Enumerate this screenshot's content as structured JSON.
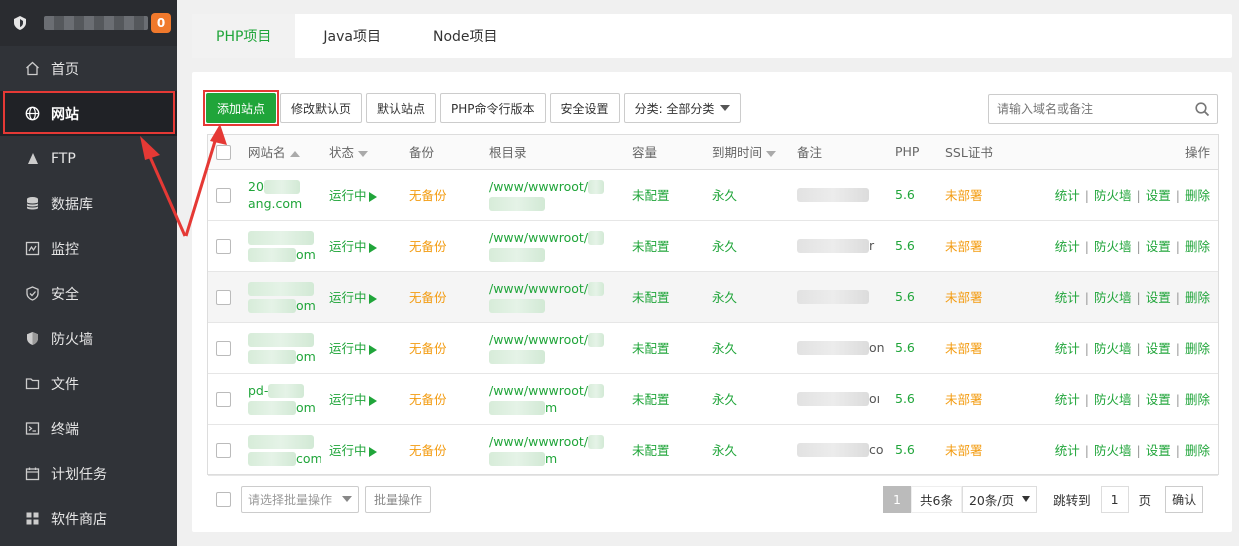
{
  "sidebar": {
    "badge": "0",
    "items": [
      {
        "label": "首页",
        "icon": "home-icon"
      },
      {
        "label": "网站",
        "icon": "globe-icon",
        "active": true
      },
      {
        "label": "FTP",
        "icon": "ftp-icon"
      },
      {
        "label": "数据库",
        "icon": "database-icon"
      },
      {
        "label": "监控",
        "icon": "monitor-icon"
      },
      {
        "label": "安全",
        "icon": "shield-icon"
      },
      {
        "label": "防火墙",
        "icon": "firewall-icon"
      },
      {
        "label": "文件",
        "icon": "folder-icon"
      },
      {
        "label": "终端",
        "icon": "terminal-icon"
      },
      {
        "label": "计划任务",
        "icon": "calendar-icon"
      },
      {
        "label": "软件商店",
        "icon": "grid-icon"
      }
    ]
  },
  "tabs": [
    {
      "label": "PHP项目",
      "active": true
    },
    {
      "label": "Java项目"
    },
    {
      "label": "Node项目"
    }
  ],
  "toolbar": {
    "add_site": "添加站点",
    "edit_default_page": "修改默认页",
    "default_site": "默认站点",
    "php_cli_version": "PHP命令行版本",
    "security_settings": "安全设置",
    "category": "分类: 全部分类"
  },
  "search": {
    "placeholder": "请输入域名或备注"
  },
  "table": {
    "headers": {
      "name": "网站名",
      "status": "状态",
      "backup": "备份",
      "root": "根目录",
      "quota": "容量",
      "expire": "到期时间",
      "note": "备注",
      "php": "PHP",
      "ssl": "SSL证书",
      "ops": "操作"
    },
    "rows": [
      {
        "name_top": "20",
        "name_bottom": "ang.com",
        "status": "运行中",
        "backup": "无备份",
        "root_top": "/www/wwwroot/",
        "root_bottom": "",
        "quota": "未配置",
        "expire": "永久",
        "note_tail": "",
        "php": "5.6",
        "ssl": "未部署"
      },
      {
        "name_top": "",
        "name_bottom": "om",
        "status": "运行中",
        "backup": "无备份",
        "root_top": "/www/wwwroot/",
        "root_bottom": "",
        "quota": "未配置",
        "expire": "永久",
        "note_tail": "r",
        "php": "5.6",
        "ssl": "未部署"
      },
      {
        "name_top": "",
        "name_bottom": "om",
        "status": "运行中",
        "backup": "无备份",
        "root_top": "/www/wwwroot/",
        "root_bottom": "",
        "quota": "未配置",
        "expire": "永久",
        "note_tail": "",
        "php": "5.6",
        "ssl": "未部署"
      },
      {
        "name_top": "",
        "name_bottom": "om",
        "status": "运行中",
        "backup": "无备份",
        "root_top": "/www/wwwroot/",
        "root_bottom": "",
        "quota": "未配置",
        "expire": "永久",
        "note_tail": "on",
        "php": "5.6",
        "ssl": "未部署"
      },
      {
        "name_top": "pd-",
        "name_bottom": "om",
        "status": "运行中",
        "backup": "无备份",
        "root_top": "/www/wwwroot/",
        "root_bottom": "m",
        "quota": "未配置",
        "expire": "永久",
        "note_tail": "oı",
        "php": "5.6",
        "ssl": "未部署"
      },
      {
        "name_top": "",
        "name_bottom": "com",
        "status": "运行中",
        "backup": "无备份",
        "root_top": "/www/wwwroot/",
        "root_bottom": "m",
        "quota": "未配置",
        "expire": "永久",
        "note_tail": "co",
        "php": "5.6",
        "ssl": "未部署"
      }
    ],
    "ops": [
      "统计",
      "防火墙",
      "设置",
      "删除"
    ]
  },
  "footer": {
    "batch_placeholder": "请选择批量操作",
    "batch_button": "批量操作",
    "current_page": "1",
    "total": "共6条",
    "page_size": "20条/页",
    "jump_label": "跳转到",
    "jump_value": "1",
    "page_unit": "页",
    "confirm": "确认"
  }
}
